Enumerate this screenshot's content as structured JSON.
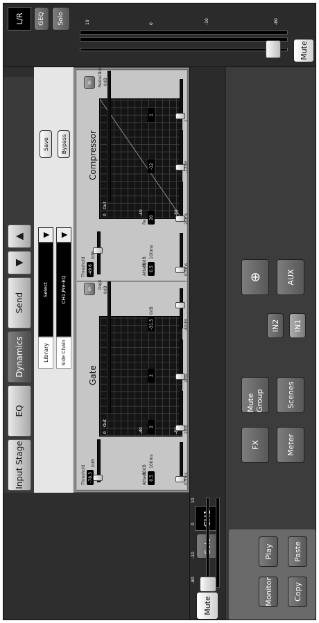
{
  "left_panel": {
    "copy": "Copy",
    "paste": "Paste",
    "monitor": "Monitor",
    "play": "Play",
    "meter": "Meter",
    "fx": "FX",
    "scenes": "Scenes",
    "mute_group": "Mute Group",
    "in1": "IN1",
    "in2": "IN2",
    "aux": "AUX",
    "compass_icon": "compass-icon"
  },
  "channel": {
    "name": "CH1",
    "solo": "Solo",
    "mute": "Mute",
    "scale": [
      "10",
      "0",
      "-10",
      "-80"
    ]
  },
  "tabs": [
    "Input Stage",
    "EQ",
    "Dynamics",
    "Send"
  ],
  "nav": {
    "up_icon": "triangle-up-icon",
    "down_icon": "triangle-down-icon"
  },
  "library": {
    "library_label": "Library",
    "select_value": "Select",
    "sidechain_label": "Side Chain",
    "sidechain_value": "CH1,Pre-EQ",
    "save": "Save",
    "bypass": "Bypass"
  },
  "gate": {
    "title": "Gate",
    "in_button": "In",
    "threshold": {
      "label": "Threshold",
      "value": "-78.3",
      "max": "0dB",
      "min": "-80dB"
    },
    "depth_meter": {
      "label": "Depth",
      "ticks": [
        "0dB",
        "-20",
        "-40",
        "-80"
      ]
    },
    "graph_labels": [
      "0",
      "Out",
      "-40",
      "-80"
    ],
    "params": [
      {
        "label": "Attack",
        "value": "0.5",
        "max": "100ms",
        "min": "0.5ms",
        "level": 0
      },
      {
        "label": "Release",
        "value": "2",
        "max": "2000ms",
        "min": "2ms",
        "level": 0
      },
      {
        "label": "Hold",
        "value": "2",
        "max": "2000ms",
        "min": "2ms",
        "level": 0
      },
      {
        "label": "Depth",
        "value": "-31.5",
        "max": "0dB",
        "min": "-80dB",
        "level": 0.6
      }
    ]
  },
  "compressor": {
    "title": "Compressor",
    "in_button": "In",
    "threshold": {
      "label": "Threshold",
      "value": "-49.6",
      "max": "0dB",
      "min": "-80dB"
    },
    "reduction_meter": {
      "label": "Reduction",
      "ticks": [
        "0dB",
        "8",
        "16",
        "24"
      ]
    },
    "graph_labels": [
      "0",
      "Out",
      "-40",
      "-80"
    ],
    "params": [
      {
        "label": "Attack",
        "value": "0.5",
        "max": "100ms",
        "min": "0.5ms",
        "level": 0
      },
      {
        "label": "Release",
        "value": "20",
        "max": "5000ms",
        "min": "20ms",
        "level": 0
      },
      {
        "label": "Gain",
        "value": "-12",
        "max": "12dB",
        "min": "-12dB",
        "level": 0
      },
      {
        "label": "Ratio",
        "value": "1",
        "max": "20",
        "min": "1",
        "level": 0
      }
    ]
  },
  "lr": {
    "name": "L/R",
    "geq": "GEQ",
    "solo": "Solo",
    "mute": "Mute",
    "scale": [
      "10",
      "0",
      "-10",
      "-80"
    ]
  }
}
